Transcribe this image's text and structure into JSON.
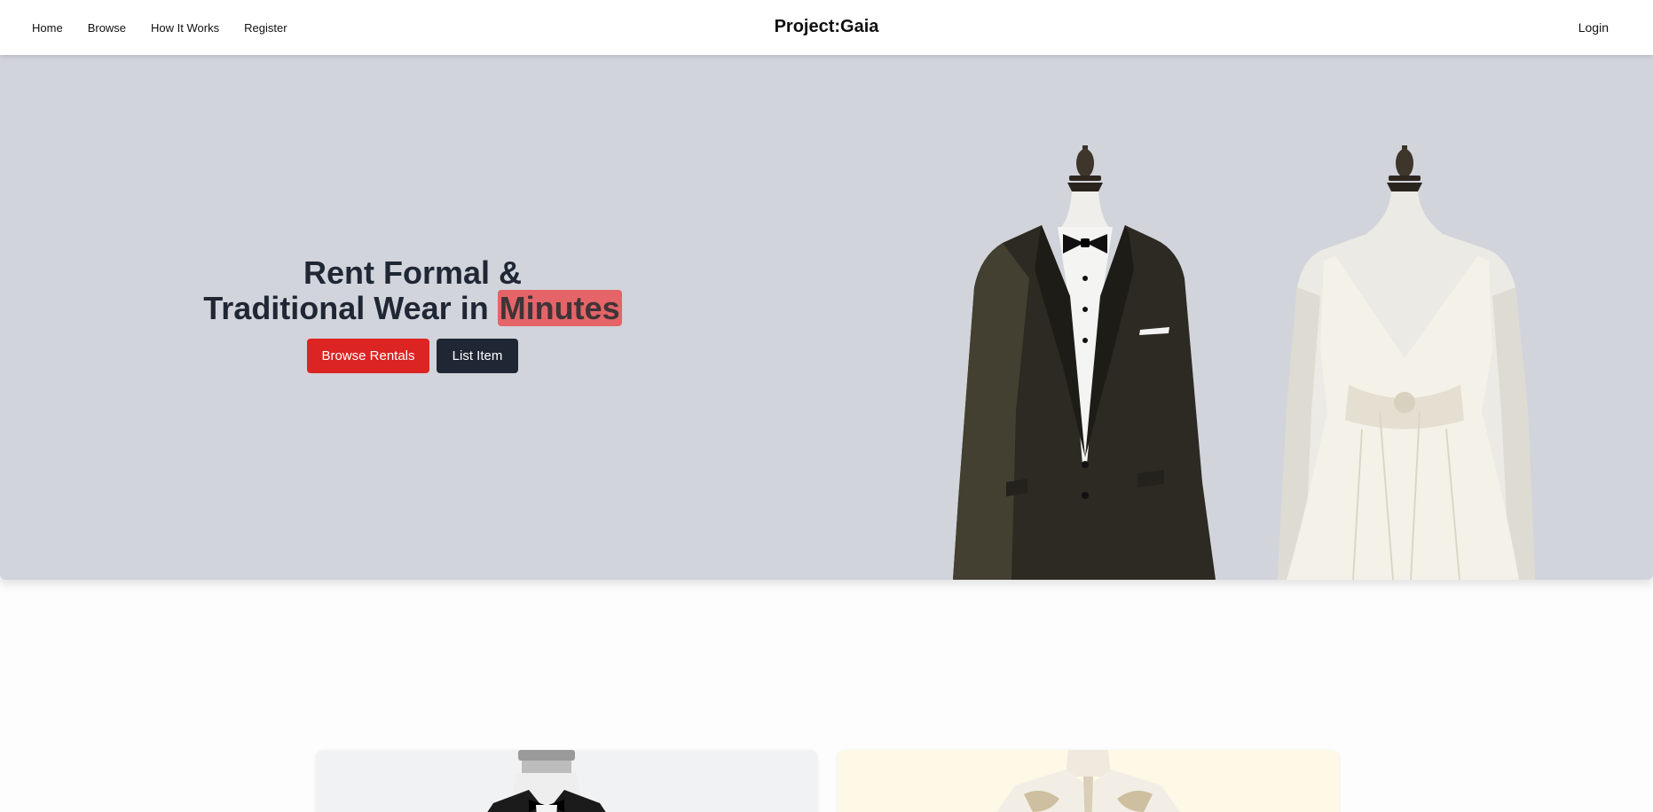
{
  "nav": {
    "links": [
      "Home",
      "Browse",
      "How It Works",
      "Register"
    ],
    "brand": "Project:Gaia",
    "login": "Login"
  },
  "hero": {
    "title_line1": "Rent Formal &",
    "title_line2_prefix": "Traditional Wear in ",
    "title_highlight": "Minutes",
    "primary_button": "Browse Rentals",
    "secondary_button": "List Item",
    "images": [
      "tuxedo-mannequin",
      "wedding-dress-mannequin"
    ]
  },
  "cards": [
    {
      "image": "tuxedo-bust"
    },
    {
      "image": "embroidered-sherwani"
    }
  ],
  "colors": {
    "hero_bg": "#d2d4db",
    "accent_red": "#dc2423",
    "dark": "#1f2735",
    "highlight": "#e46468"
  }
}
